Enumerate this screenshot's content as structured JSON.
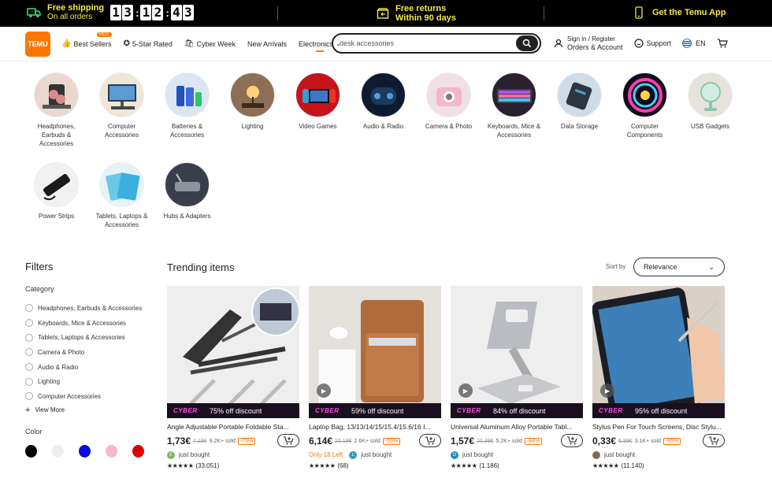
{
  "promo": {
    "shipping_title": "Free shipping",
    "shipping_sub": "On all orders",
    "countdown": [
      "1",
      "3",
      ":",
      "1",
      "2",
      ":",
      "4",
      "3"
    ],
    "returns_title": "Free returns",
    "returns_sub": "Within 90 days",
    "app": "Get the Temu App"
  },
  "header": {
    "logo": "TEMU",
    "nav": {
      "best_sellers": "Best Sellers",
      "hot": "HOT",
      "five_star": "5-Star Rated",
      "cyber_week": "Cyber Week",
      "new_arrivals": "New Arrivals",
      "electronics": "Electronics"
    },
    "search_value": "desk accessories",
    "signin": "Sign in / Register",
    "orders": "Orders & Account",
    "support": "Support",
    "lang": "EN"
  },
  "categories": [
    {
      "label": "Headphones, Earbuds & Accessories",
      "icon": "headphones"
    },
    {
      "label": "Computer Accessories",
      "icon": "monitor"
    },
    {
      "label": "Batteries & Accessories",
      "icon": "battery"
    },
    {
      "label": "Lighting",
      "icon": "lamp"
    },
    {
      "label": "Video Games",
      "icon": "console"
    },
    {
      "label": "Audio & Radio",
      "icon": "speaker"
    },
    {
      "label": "Camera & Photo",
      "icon": "camera"
    },
    {
      "label": "Keyboards, Mice & Accessories",
      "icon": "keyboard"
    },
    {
      "label": "Data Storage",
      "icon": "drive"
    },
    {
      "label": "Computer Components",
      "icon": "rgb-fan"
    },
    {
      "label": "USB Gadgets",
      "icon": "fan"
    },
    {
      "label": "Power Strips",
      "icon": "power-strip"
    },
    {
      "label": "Tablets, Laptops & Accessories",
      "icon": "tablet"
    },
    {
      "label": "Hubs & Adapters",
      "icon": "hub"
    }
  ],
  "filters": {
    "title": "Filters",
    "category_title": "Category",
    "categories": [
      "Headphones, Earbuds & Accessories",
      "Keyboards, Mice & Accessories",
      "Tablets, Laptops & Accessories",
      "Camera & Photo",
      "Audio & Radio",
      "Lighting",
      "Computer Accessories"
    ],
    "view_more": "View More",
    "color_title": "Color",
    "colors": [
      "#000000",
      "#eeeeee",
      "#0a0ae0",
      "#f7b8c8",
      "#e00000"
    ]
  },
  "trending": {
    "title": "Trending items",
    "sort_label": "Sort by",
    "sort_value": "Relevance"
  },
  "products": [
    {
      "title": "Angle Adjustable Portable Foldable Sta...",
      "price": "1,73€",
      "old": "7,19€",
      "sold": "9.2K+ sold",
      "discount": "-75%",
      "cyber": "75% off discount",
      "bought": "just bought",
      "left": "",
      "rating": "(33.051)",
      "stars": "★★★★★"
    },
    {
      "title": "Laptop Bag, 13/13/14/15/15.4/15.6/16 I...",
      "price": "6,14€",
      "old": "15,19€",
      "sold": "2.6K+ sold",
      "discount": "-59%",
      "cyber": "59% off discount",
      "bought": "just bought",
      "left": "Only 18 Left",
      "rating": "(68)",
      "stars": "★★★★★"
    },
    {
      "title": "Universal Aluminum Alloy Portable Tabl...",
      "price": "1,57€",
      "old": "10,39€",
      "sold": "5.2K+ sold",
      "discount": "-84%",
      "cyber": "84% off discount",
      "bought": "just bought",
      "left": "",
      "rating": "(1.186)",
      "stars": "★★★★★"
    },
    {
      "title": "Stylus Pen For Touch Screens, Disc Stylu...",
      "price": "0,33€",
      "old": "6,99€",
      "sold": "3.1K+ sold",
      "discount": "-95%",
      "cyber": "95% off discount",
      "bought": "just bought",
      "left": "",
      "rating": "(11.140)",
      "stars": "★★★★★"
    }
  ]
}
